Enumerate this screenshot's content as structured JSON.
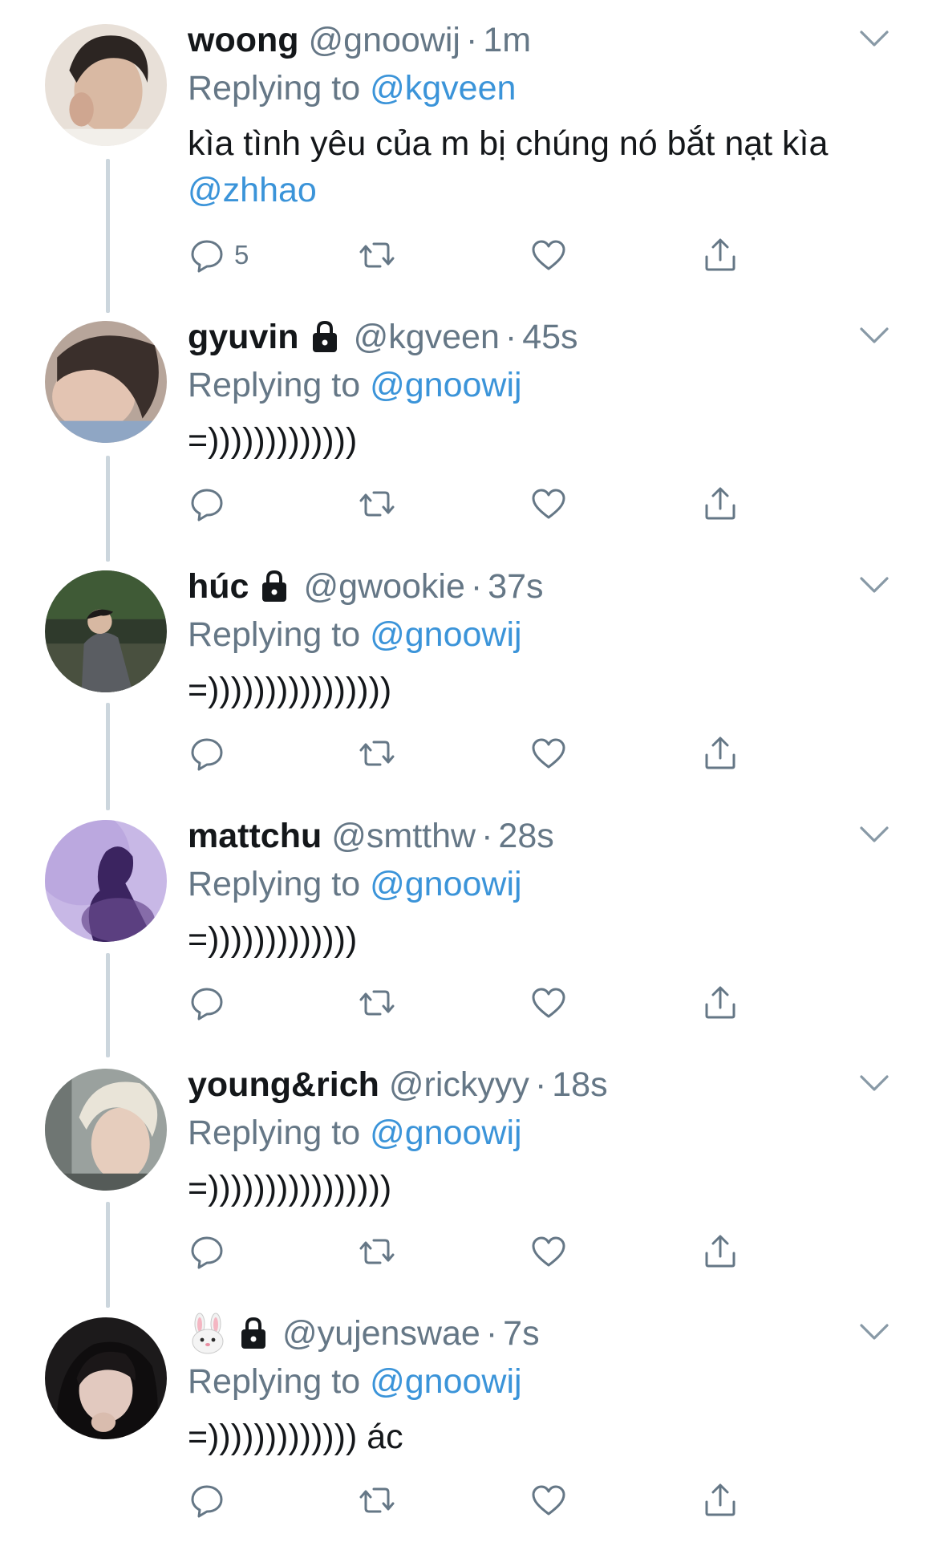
{
  "colors": {
    "text": "#14171a",
    "secondary": "#657786",
    "link": "#3b94d9",
    "thread_line": "#ccd6dd"
  },
  "tweets": [
    {
      "display_name": "woong",
      "name_emoji": "",
      "locked": false,
      "handle": "@gnoowij",
      "time": "1m",
      "replying_prefix": "Replying to",
      "replying_to": "@kgveen",
      "text": "kìa tình yêu của m bị chúng nó bắt nạt kìa",
      "text_mention": "@zhhao",
      "reply_count": "5"
    },
    {
      "display_name": "gyuvin",
      "name_emoji": "",
      "locked": true,
      "handle": "@kgveen",
      "time": "45s",
      "replying_prefix": "Replying to",
      "replying_to": "@gnoowij",
      "text": "=)))))))))))))",
      "text_mention": "",
      "reply_count": ""
    },
    {
      "display_name": "húc",
      "name_emoji": "",
      "locked": true,
      "handle": "@gwookie",
      "time": "37s",
      "replying_prefix": "Replying to",
      "replying_to": "@gnoowij",
      "text": "=))))))))))))))))",
      "text_mention": "",
      "reply_count": ""
    },
    {
      "display_name": "mattchu",
      "name_emoji": "",
      "locked": false,
      "handle": "@smtthw",
      "time": "28s",
      "replying_prefix": "Replying to",
      "replying_to": "@gnoowij",
      "text": "=)))))))))))))",
      "text_mention": "",
      "reply_count": ""
    },
    {
      "display_name": "young&rich",
      "name_emoji": "",
      "locked": false,
      "handle": "@rickyyy",
      "time": "18s",
      "replying_prefix": "Replying to",
      "replying_to": "@gnoowij",
      "text": "=))))))))))))))))",
      "text_mention": "",
      "reply_count": ""
    },
    {
      "display_name": "",
      "name_emoji": "rabbit-face-emoji",
      "locked": true,
      "handle": "@yujenswae",
      "time": "7s",
      "replying_prefix": "Replying to",
      "replying_to": "@gnoowij",
      "text": "=))))))))))))) ác",
      "text_mention": "",
      "reply_count": ""
    }
  ],
  "icons": {
    "reply": "comment-bubble-icon",
    "retweet": "retweet-icon",
    "like": "heart-icon",
    "share": "share-upload-icon",
    "more": "chevron-down-icon",
    "lock": "padlock-icon"
  },
  "separator": "·"
}
